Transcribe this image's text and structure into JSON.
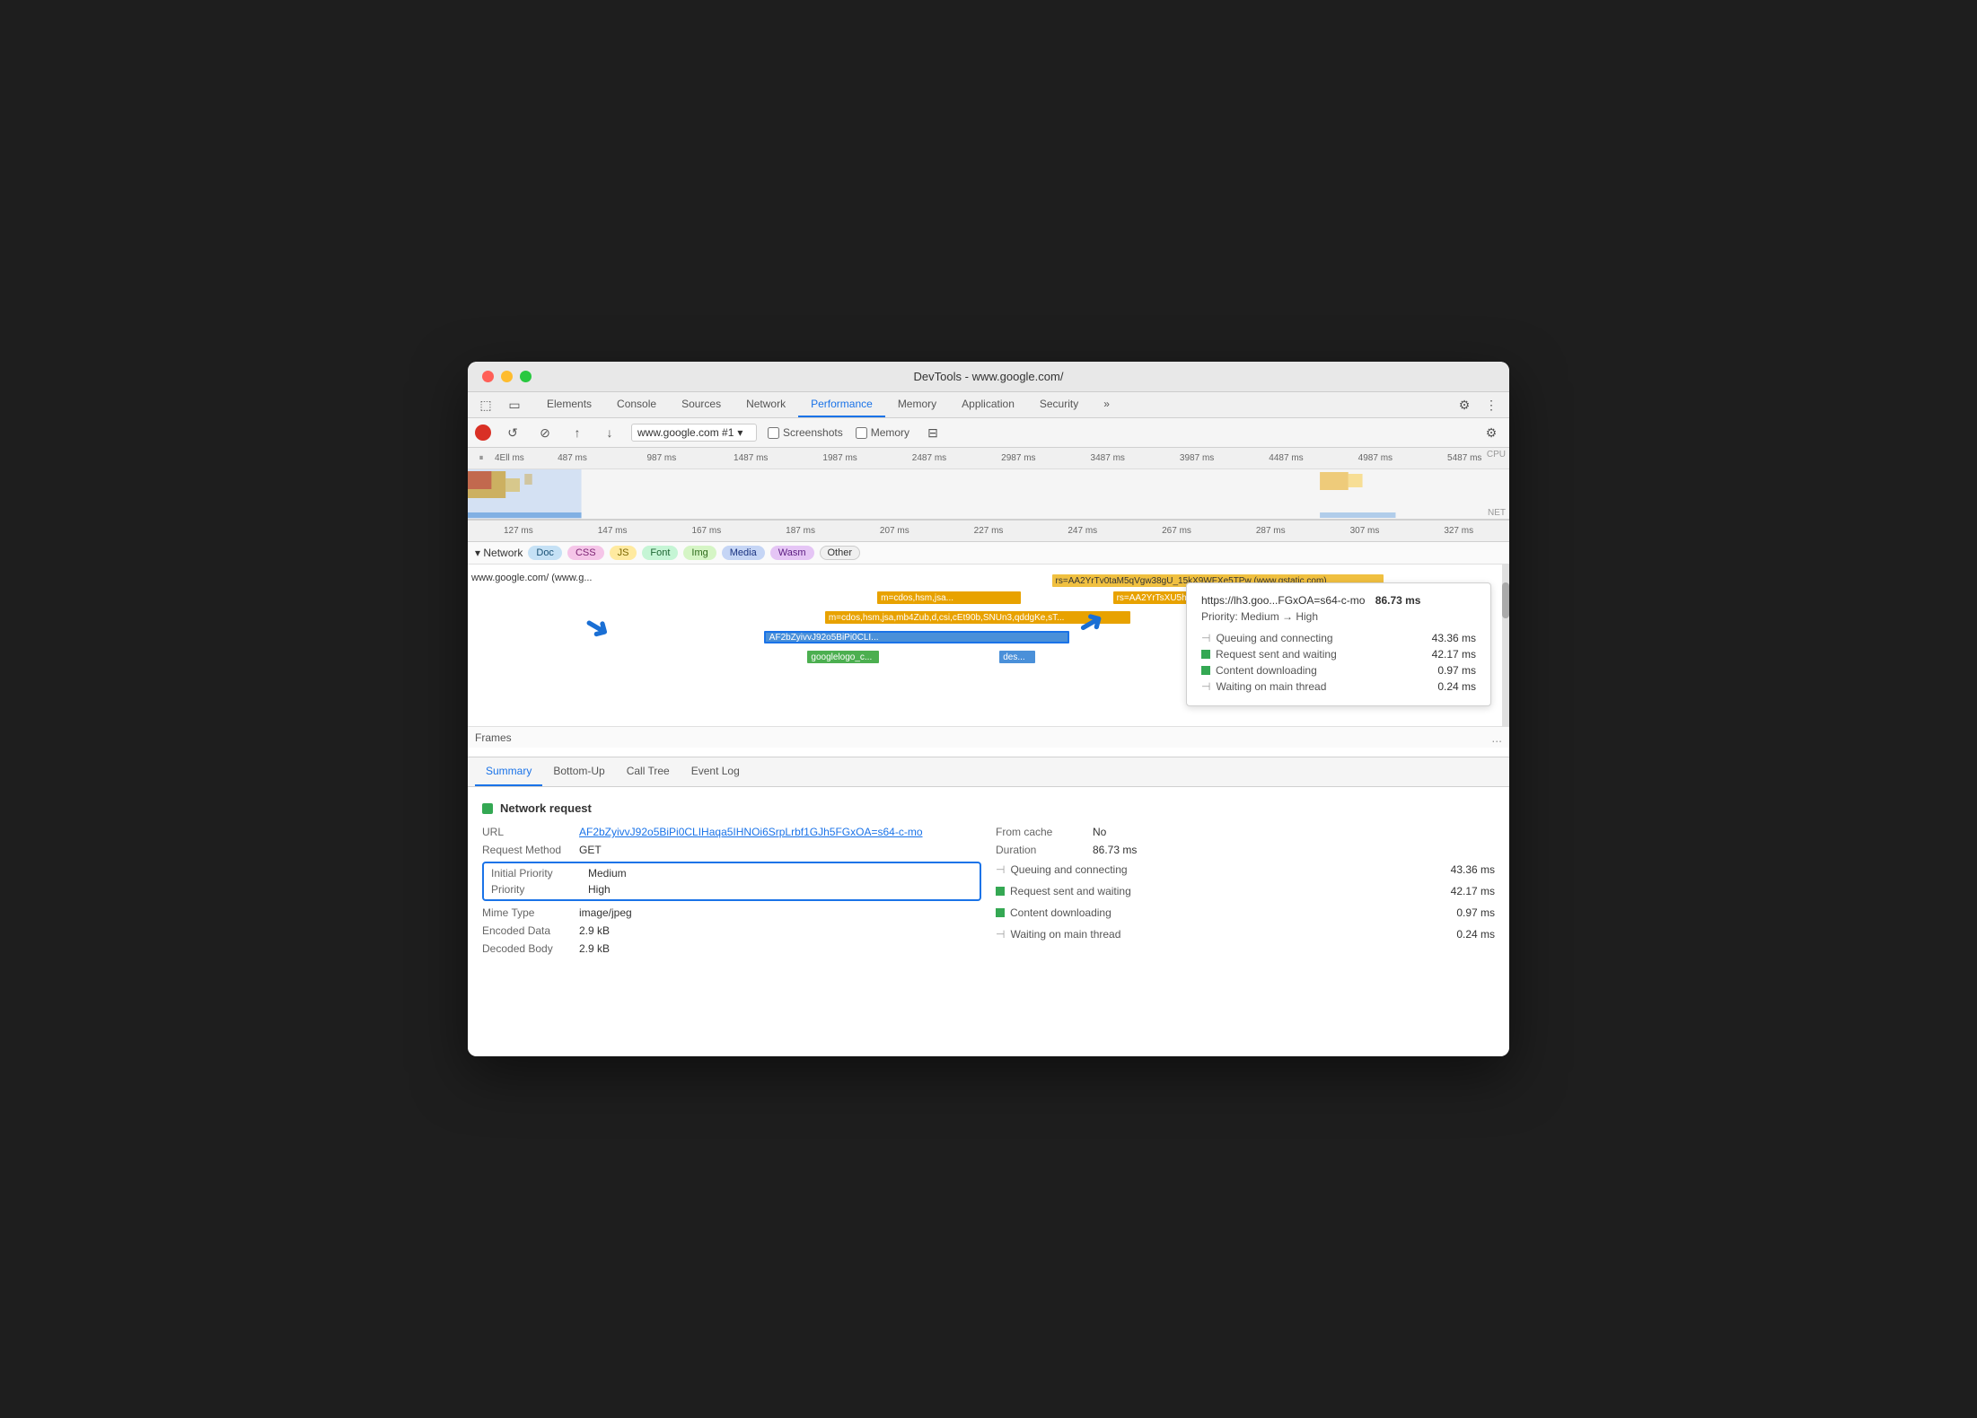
{
  "window": {
    "title": "DevTools - www.google.com/"
  },
  "traffic_lights": {
    "red": "red",
    "yellow": "yellow",
    "green": "green"
  },
  "toolbar": {
    "tabs": [
      {
        "label": "Elements",
        "active": false
      },
      {
        "label": "Console",
        "active": false
      },
      {
        "label": "Sources",
        "active": false
      },
      {
        "label": "Network",
        "active": false
      },
      {
        "label": "Performance",
        "active": true
      },
      {
        "label": "Memory",
        "active": false
      },
      {
        "label": "Application",
        "active": false
      },
      {
        "label": "Security",
        "active": false
      },
      {
        "label": "»",
        "active": false
      }
    ]
  },
  "devtools_bar": {
    "url_selector": "www.google.com #1",
    "screenshots_label": "Screenshots",
    "memory_label": "Memory"
  },
  "timeline": {
    "labels": [
      "487 ms",
      "987 ms",
      "1487 ms",
      "1987 ms",
      "2487 ms",
      "2987 ms",
      "3487 ms",
      "3987 ms",
      "4487 ms",
      "4987 ms",
      "5487 ms"
    ],
    "cpu_label": "CPU",
    "net_label": "NET",
    "zoom_labels": [
      "127 ms",
      "147 ms",
      "167 ms",
      "187 ms",
      "207 ms",
      "227 ms",
      "247 ms",
      "267 ms",
      "287 ms",
      "307 ms",
      "327 ms"
    ]
  },
  "network": {
    "section_label": "Network",
    "filters": [
      "Doc",
      "CSS",
      "JS",
      "Font",
      "Img",
      "Media",
      "Wasm",
      "Other"
    ],
    "rows": [
      {
        "label": "www.google.com/ (www.g...",
        "bar_label": "rs=AA2YrTv0taM5qVgw38gU_15kX9WFXe5TPw (www.gstatic.com)"
      },
      {
        "label": "",
        "bar_label": "m=cdos,hsm,jsa..."
      },
      {
        "label": "",
        "bar_label": "rs=AA2YrTsXU5hjdOZrxXehYcpWx5c..."
      },
      {
        "label": "",
        "bar_label": "m=cdos,hsm,jsa,mb4Zub,d,csi,cEt90b,SNUn3,qddgKe,sT..."
      },
      {
        "label": "",
        "bar_label": "AF2bZyivvJ92o5BiPi0CLIHaqa5IHNOi6SrpLrbf1GJh5FGxOA=s64-c-mo"
      },
      {
        "label": "",
        "bar_label": "googlelogo_c..."
      },
      {
        "label": "",
        "bar_label": "des..."
      }
    ],
    "frames_label": "Frames",
    "more_icon": "..."
  },
  "tooltip": {
    "url": "https://lh3.goo...FGxOA=s64-c-mo",
    "duration": "86.73 ms",
    "priority_text": "Priority: Medium → High",
    "rows": [
      {
        "icon": "line",
        "label": "Queuing and connecting",
        "value": "43.36 ms"
      },
      {
        "icon": "bar",
        "label": "Request sent and waiting",
        "value": "42.17 ms"
      },
      {
        "icon": "bar",
        "label": "Content downloading",
        "value": "0.97 ms"
      },
      {
        "icon": "line",
        "label": "Waiting on main thread",
        "value": "0.24 ms"
      }
    ]
  },
  "panel_tabs": [
    {
      "label": "Summary",
      "active": true
    },
    {
      "label": "Bottom-Up",
      "active": false
    },
    {
      "label": "Call Tree",
      "active": false
    },
    {
      "label": "Event Log",
      "active": false
    }
  ],
  "detail": {
    "section_title": "Network request",
    "url_label": "URL",
    "url_value": "AF2bZyivvJ92o5BiPi0CLIHaqa5IHNOi6SrpLrbf1GJh5FGxOA=s64-c-mo",
    "request_method_label": "Request Method",
    "request_method_value": "GET",
    "initial_priority_label": "Initial Priority",
    "initial_priority_value": "Medium",
    "priority_label": "Priority",
    "priority_value": "High",
    "mime_type_label": "Mime Type",
    "mime_type_value": "image/jpeg",
    "encoded_data_label": "Encoded Data",
    "encoded_data_value": "2.9 kB",
    "decoded_body_label": "Decoded Body",
    "decoded_body_value": "2.9 kB",
    "from_cache_label": "From cache",
    "from_cache_value": "No",
    "duration_label": "Duration",
    "duration_value": "86.73 ms",
    "timing_rows": [
      {
        "icon": "line",
        "label": "Queuing and connecting",
        "value": "43.36 ms"
      },
      {
        "icon": "bar",
        "label": "Request sent and waiting",
        "value": "42.17 ms"
      },
      {
        "icon": "bar",
        "label": "Content downloading",
        "value": "0.97 ms"
      },
      {
        "icon": "line",
        "label": "Waiting on main thread",
        "value": "0.24 ms"
      }
    ]
  }
}
